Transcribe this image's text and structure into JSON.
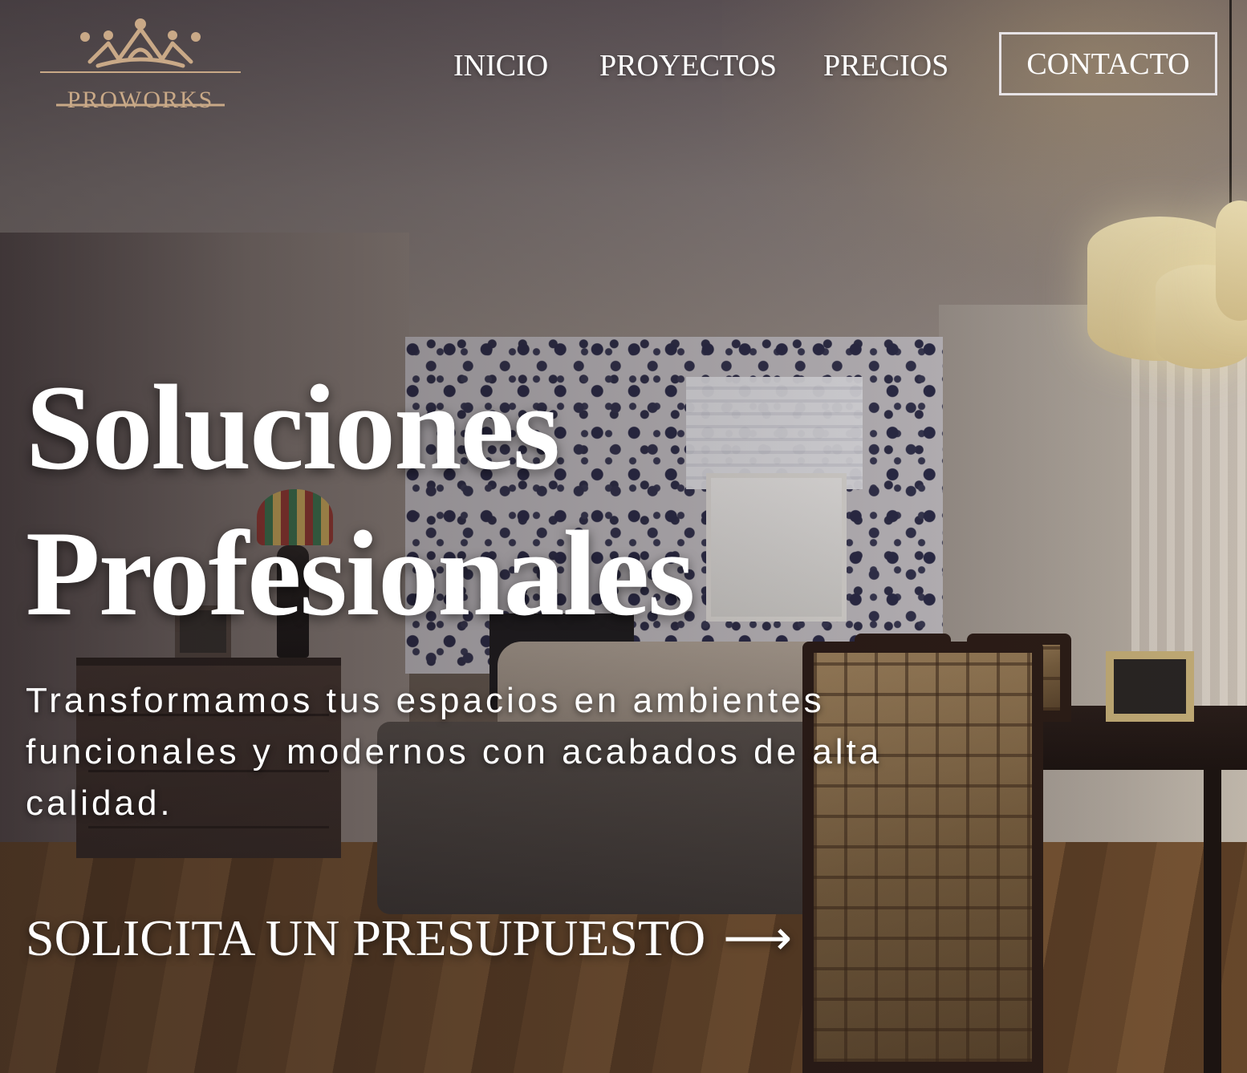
{
  "brand": {
    "name": "PROWORKS",
    "logo_icon": "crown-icon",
    "accent_color": "#c9a987"
  },
  "nav": {
    "items": [
      {
        "label": "INICIO"
      },
      {
        "label": "PROYECTOS"
      },
      {
        "label": "PRECIOS"
      }
    ],
    "cta_label": "CONTACTO"
  },
  "hero": {
    "title_line_1": "Soluciones",
    "title_line_2": "Profesionales",
    "subtitle": "Transformamos tus espacios en ambientes funcionales y modernos con acabados de alta calidad.",
    "cta_label": "SOLICITA UN PRESUPUESTO",
    "cta_arrow": "⟶",
    "cta_icon": "arrow-right-icon"
  }
}
